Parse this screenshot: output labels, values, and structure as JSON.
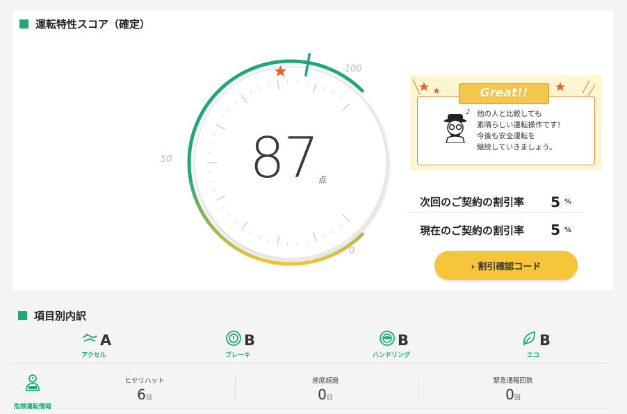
{
  "score_section": {
    "title": "運転特性スコア（確定）",
    "score": "87",
    "score_unit": "点",
    "score_value": 87,
    "gauge_labels": {
      "max": "100",
      "mid": "50",
      "min": "0"
    },
    "colors": {
      "green": "#1fa77a",
      "yellow": "#f2c233",
      "star": "#e0662b"
    }
  },
  "message_card": {
    "badge": "Great!!",
    "lines": [
      "他の人と比較しても",
      "素晴らしい運転操作です！",
      "今後も安全運転を",
      "継続していきましょう。"
    ]
  },
  "rates": {
    "next": {
      "label": "次回のご契約の割引率",
      "value": "5",
      "unit": "%"
    },
    "current": {
      "label": "現在のご契約の割引率",
      "value": "5",
      "unit": "%"
    }
  },
  "code_button": {
    "label": "› 割引確認コード"
  },
  "breakdown": {
    "title": "項目別内訳",
    "categories": [
      {
        "name": "アクセル",
        "grade": "A",
        "icon": "accelerator-icon"
      },
      {
        "name": "ブレーキ",
        "grade": "B",
        "icon": "brake-icon"
      },
      {
        "name": "ハンドリング",
        "grade": "B",
        "icon": "steering-wheel-icon"
      },
      {
        "name": "エコ",
        "grade": "B",
        "icon": "leaf-icon"
      }
    ]
  },
  "risk": {
    "label": "危険運転情報",
    "metrics": [
      {
        "label": "ヒヤリハット",
        "value": "6",
        "unit": "日"
      },
      {
        "label": "速度超過",
        "value": "0",
        "unit": "日"
      },
      {
        "label": "緊急通報回数",
        "value": "0",
        "unit": "回"
      }
    ]
  }
}
